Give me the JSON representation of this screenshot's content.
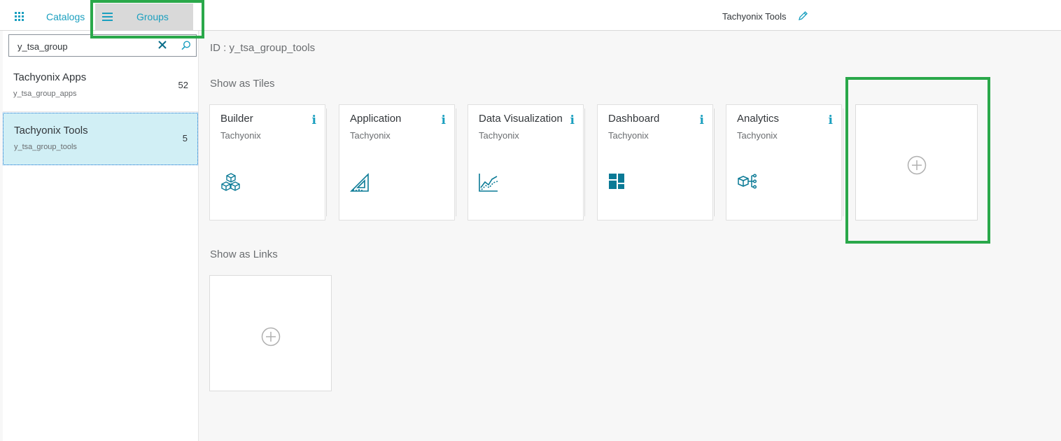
{
  "header": {
    "tabs": [
      {
        "label": "Catalogs",
        "icon": "apps-icon"
      },
      {
        "label": "Groups",
        "icon": "menu-icon",
        "selected": true
      }
    ],
    "title": "Tachyonix Tools"
  },
  "search": {
    "value": "y_tsa_group"
  },
  "groups": [
    {
      "title": "Tachyonix Apps",
      "id": "y_tsa_group_apps",
      "count": "52"
    },
    {
      "title": "Tachyonix Tools",
      "id": "y_tsa_group_tools",
      "count": "5",
      "selected": true
    }
  ],
  "main": {
    "id_line": "ID : y_tsa_group_tools",
    "tiles_section": "Show as Tiles",
    "links_section": "Show as Links",
    "tiles": [
      {
        "title": "Builder",
        "subtitle": "Tachyonix",
        "icon": "cubes-icon"
      },
      {
        "title": "Application",
        "subtitle": "Tachyonix",
        "icon": "set-square-icon"
      },
      {
        "title": "Data Visualization",
        "subtitle": "Tachyonix",
        "icon": "line-chart-icon"
      },
      {
        "title": "Dashboard",
        "subtitle": "Tachyonix",
        "icon": "dashboard-icon"
      },
      {
        "title": "Analytics",
        "subtitle": "Tachyonix",
        "icon": "network-cube-icon"
      }
    ],
    "info_glyph": "i"
  },
  "colors": {
    "accent": "#1a9fbf",
    "highlight": "#2aa84a",
    "selected_bg": "#d1eff5"
  }
}
